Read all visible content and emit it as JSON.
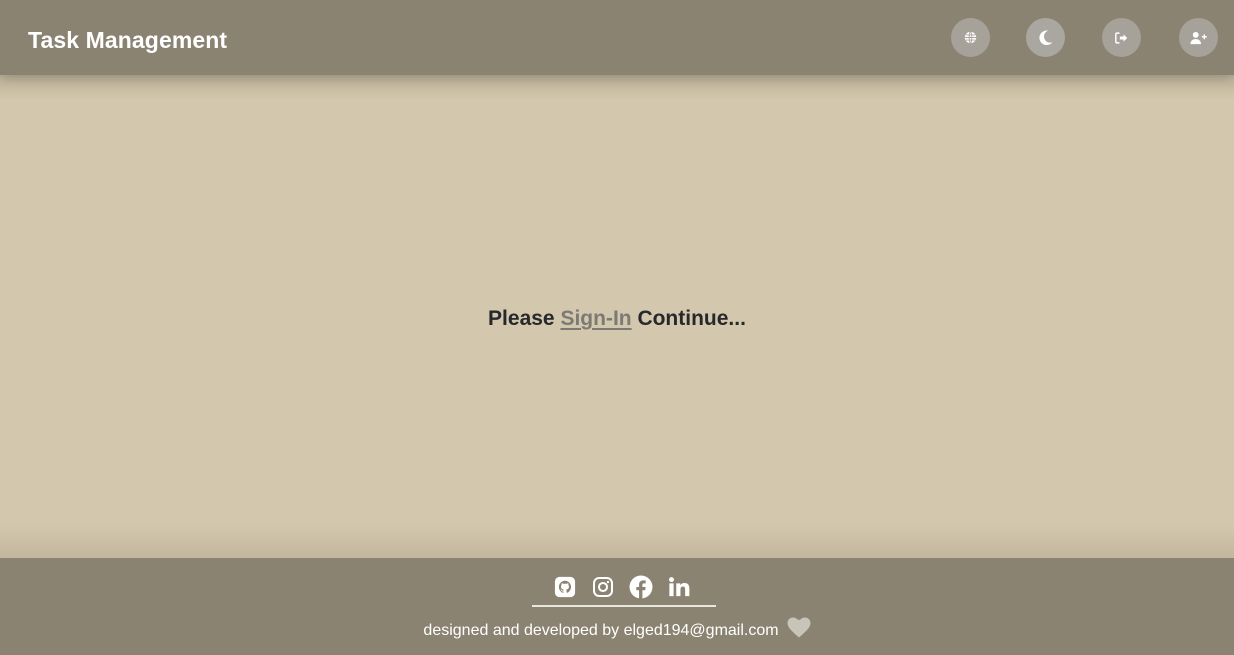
{
  "header": {
    "title": "Task Management",
    "buttons": [
      {
        "name": "language",
        "icon": "globe-icon"
      },
      {
        "name": "theme",
        "icon": "moon-icon"
      },
      {
        "name": "logout",
        "icon": "sign-out-icon"
      },
      {
        "name": "add-user",
        "icon": "user-plus-icon"
      }
    ]
  },
  "main": {
    "prompt_before": "Please ",
    "signin_link": "Sign-In",
    "prompt_after": " Continue..."
  },
  "footer": {
    "social_links": [
      {
        "name": "github",
        "icon": "github-icon"
      },
      {
        "name": "instagram",
        "icon": "instagram-icon"
      },
      {
        "name": "facebook",
        "icon": "facebook-icon"
      },
      {
        "name": "linkedin",
        "icon": "linkedin-icon"
      }
    ],
    "credit": "designed and developed by elged194@gmail.com",
    "heart_icon": "heart-icon"
  },
  "colors": {
    "header_bg": "#8b8371",
    "page_bg": "#d3c7ad",
    "link": "#7d7a75",
    "text": "#27282c"
  }
}
